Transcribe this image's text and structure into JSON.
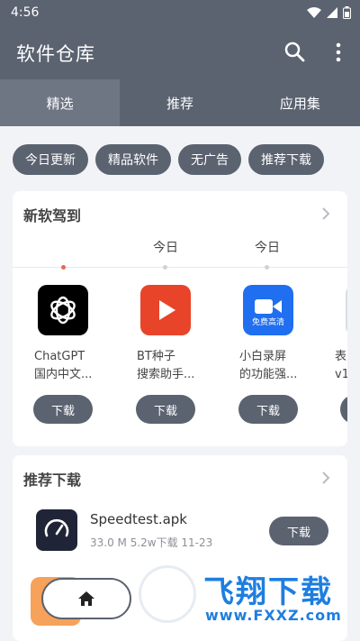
{
  "status": {
    "time": "4:56"
  },
  "header": {
    "title": "软件仓库"
  },
  "tabs": [
    {
      "label": "精选",
      "active": true
    },
    {
      "label": "推荐",
      "active": false
    },
    {
      "label": "应用集",
      "active": false
    }
  ],
  "chips": [
    "今日更新",
    "精品软件",
    "无广告",
    "推荐下载"
  ],
  "new_section": {
    "title": "新软驾到",
    "day_labels": [
      "今日",
      "今日"
    ],
    "apps": [
      {
        "name_line1": "ChatGPT",
        "name_line2": "国内中文...",
        "button": "下载",
        "icon": "openai-logo-icon"
      },
      {
        "name_line1": "BT种子",
        "name_line2": "搜索助手...",
        "button": "下载",
        "icon": "youtube-play-icon"
      },
      {
        "name_line1": "小白录屏",
        "name_line2": "的功能强...",
        "button": "下载",
        "icon": "video-camera-icon",
        "icon_badge": "免费高清"
      },
      {
        "name_line1": "表",
        "name_line2": "v1",
        "button": "下载",
        "icon": "partial-app-icon"
      }
    ]
  },
  "rec_section": {
    "title": "推荐下载",
    "items": [
      {
        "name": "Speedtest.apk",
        "meta": "33.0 M  5.2w下载  11-23",
        "button": "下载",
        "icon": "speedometer-icon"
      }
    ]
  },
  "watermark": {
    "text": "飞翔下载",
    "url": "www.FXXZ.com"
  },
  "colors": {
    "header": "#5b6270",
    "accent_dot": "#e46a4a",
    "watermark": "#1e7ee0"
  }
}
